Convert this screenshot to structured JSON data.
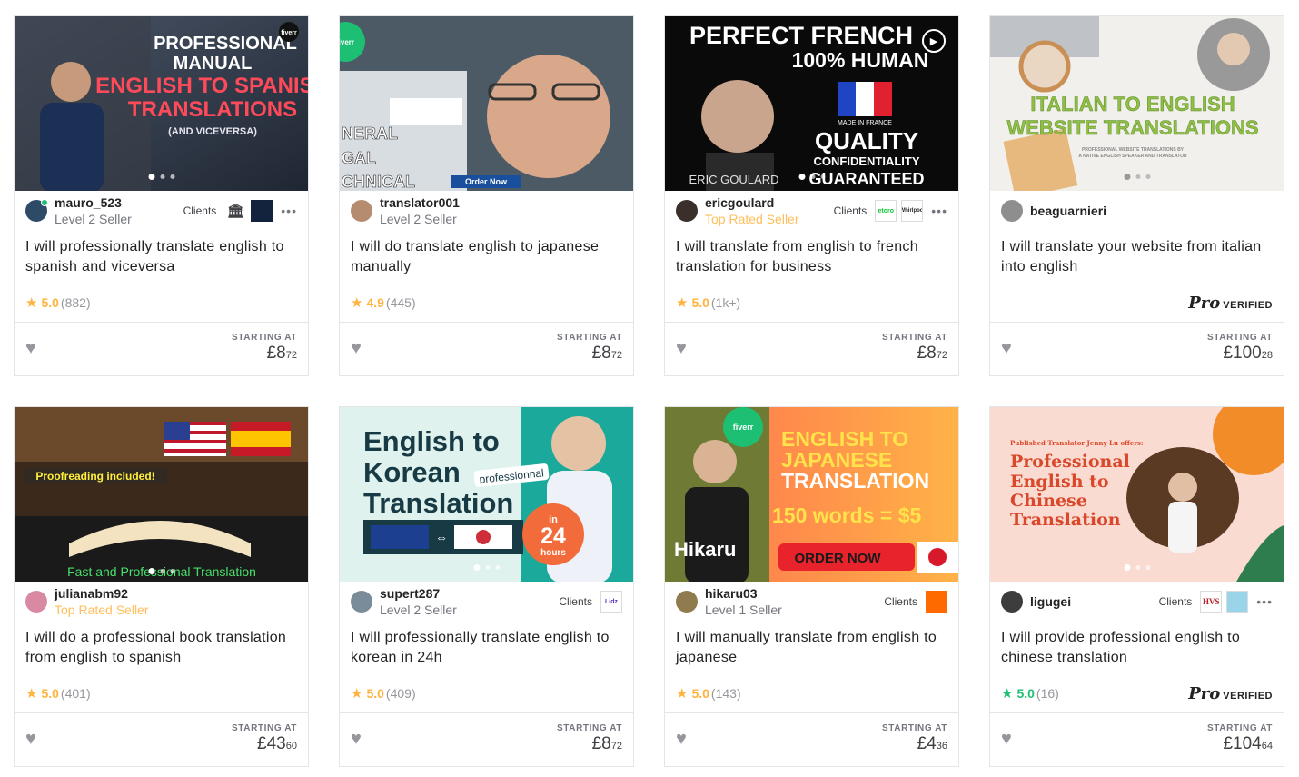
{
  "labels": {
    "clients": "Clients",
    "starting_at": "STARTING AT",
    "pro": "Pro",
    "verified": "VERIFIED"
  },
  "colors": {
    "rating_star": "#ffb33e",
    "pro_star": "#1dbf73",
    "top_rated": "#ffbe5b",
    "online": "#1dbf73"
  },
  "gigs": [
    {
      "thumb_lines": [
        "PROFESSIONAL",
        "MANUAL",
        "ENGLISH TO SPANISH",
        "TRANSLATIONS",
        "(AND VICEVERSA)"
      ],
      "thumb_badge": "fiverr",
      "username": "mauro_523",
      "level": "Level 2 Seller",
      "clients": [
        "museum-logo",
        "brand-logo"
      ],
      "title": "I will professionally translate english to spanish and viceversa",
      "rating": "5.0",
      "count": "(882)",
      "price_main": "£8",
      "price_cents": "72"
    },
    {
      "thumb_lines": [
        "NERAL",
        "GAL",
        "CHNICAL",
        "Order Now"
      ],
      "thumb_badge": "fiverr",
      "username": "translator001",
      "level": "Level 2 Seller",
      "clients": [],
      "title": "I will do translate english to japanese manually",
      "rating": "4.9",
      "count": "(445)",
      "price_main": "£8",
      "price_cents": "72"
    },
    {
      "thumb_lines": [
        "PERFECT FRENCH",
        "100% HUMAN",
        "MADE IN FRANCE",
        "QUALITY",
        "CONFIDENTIALITY",
        "GUARANTEED",
        "ERIC GOULARD"
      ],
      "username": "ericgoulard",
      "level": "Top Rated Seller",
      "clients": [
        "etoro",
        "Whirlpool"
      ],
      "title": "I will translate from english to french translation for business",
      "rating": "5.0",
      "count": "(1k+)",
      "price_main": "£8",
      "price_cents": "72"
    },
    {
      "thumb_lines": [
        "ITALIAN TO ENGLISH",
        "WEBSITE TRANSLATIONS",
        "PROFESSIONAL WEBSITE TRANSLATIONS BY",
        "A NATIVE ENGLISH SPEAKER AND TRANSLATOR"
      ],
      "username": "beaguarnieri",
      "level": "",
      "clients": [],
      "title": "I will translate your website from italian into english",
      "pro_verified": true,
      "price_main": "£100",
      "price_cents": "28"
    },
    {
      "thumb_lines": [
        "Proofreading included!",
        "Fast and Professional Translation"
      ],
      "username": "julianabm92",
      "level": "Top Rated Seller",
      "clients": [],
      "title": "I will do a professional book translation from english to spanish",
      "rating": "5.0",
      "count": "(401)",
      "price_main": "£43",
      "price_cents": "60"
    },
    {
      "thumb_lines": [
        "English to",
        "Korean",
        "Translation",
        "professionnal",
        "in",
        "24",
        "hours"
      ],
      "username": "supert287",
      "level": "Level 2 Seller",
      "clients": [
        "Lidz"
      ],
      "title": "I will professionally translate english to korean in 24h",
      "rating": "5.0",
      "count": "(409)",
      "price_main": "£8",
      "price_cents": "72"
    },
    {
      "thumb_lines": [
        "ENGLISH TO",
        "JAPANESE",
        "TRANSLATION",
        "150 words = $5",
        "Hikaru",
        "ORDER NOW"
      ],
      "thumb_badge": "fiverr",
      "username": "hikaru03",
      "level": "Level 1 Seller",
      "clients": [
        "orange-logo"
      ],
      "title": "I will manually translate from english to japanese",
      "rating": "5.0",
      "count": "(143)",
      "price_main": "£4",
      "price_cents": "36"
    },
    {
      "thumb_lines": [
        "Published Translator Jenny Lu offers:",
        "Professional",
        "English to",
        "Chinese",
        "Translation"
      ],
      "username": "ligugei",
      "level": "",
      "clients": [
        "HVS",
        "colorful-logo"
      ],
      "title": "I will provide professional english to chinese translation",
      "rating": "5.0",
      "count": "(16)",
      "rating_green": true,
      "pro_verified": true,
      "price_main": "£104",
      "price_cents": "64"
    }
  ]
}
